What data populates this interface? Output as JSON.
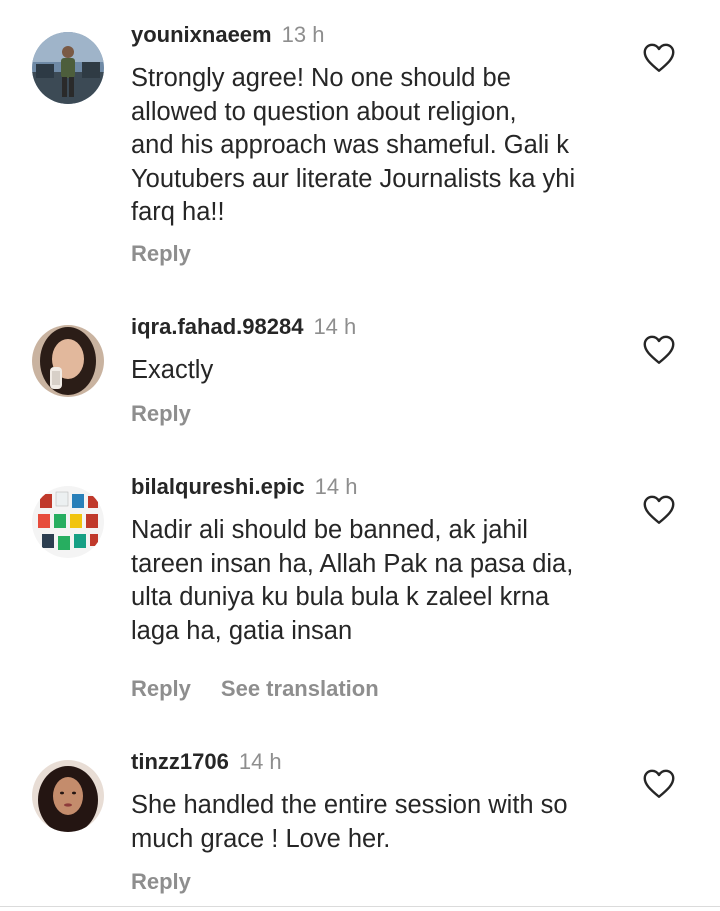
{
  "comments": [
    {
      "username": "younixnaeem",
      "time": "13 h",
      "lines": [
        "Strongly agree! No one should be",
        "allowed to question about religion,",
        "and his approach was shameful. Gali k",
        "Youtubers aur literate Journalists ka yhi",
        "farq ha!!"
      ],
      "reply_label": "Reply"
    },
    {
      "username": "iqra.fahad.98284",
      "time": "14 h",
      "lines": [
        "Exactly"
      ],
      "reply_label": "Reply"
    },
    {
      "username": "bilalqureshi.epic",
      "time": "14 h",
      "lines": [
        "Nadir ali should be banned, ak jahil",
        "tareen insan ha, Allah Pak na pasa dia,",
        "ulta duniya ku bula bula k zaleel krna",
        "laga ha, gatia insan"
      ],
      "reply_label": "Reply",
      "translation_label": "See translation"
    },
    {
      "username": "tinzz1706",
      "time": "14 h",
      "lines": [
        "She handled the entire session with so",
        "much grace ! Love her."
      ],
      "reply_label": "Reply"
    }
  ],
  "icons": {
    "like": "heart-outline-icon",
    "avatar": "avatar-photo"
  },
  "colors": {
    "primary_text": "#262626",
    "secondary_text": "#8e8e8e",
    "icon": "#262626"
  }
}
